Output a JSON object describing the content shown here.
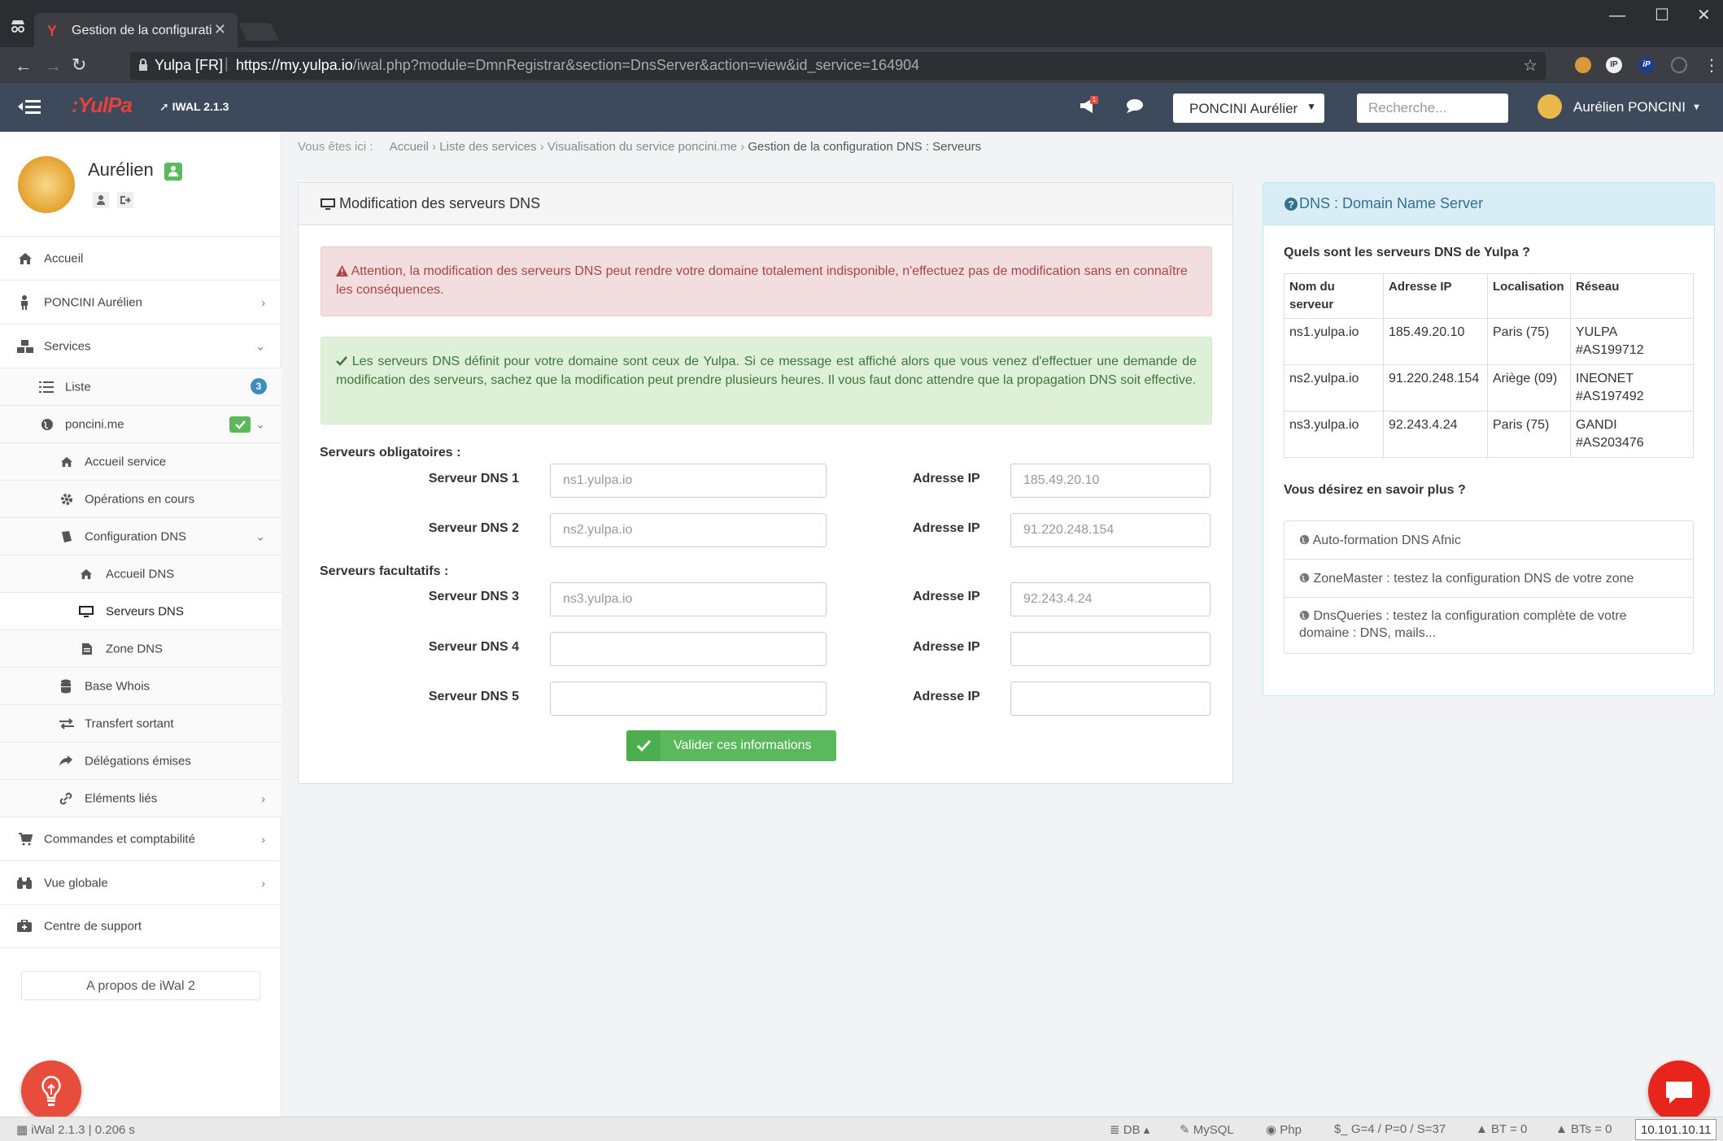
{
  "browser": {
    "tab_title": "Gestion de la configuratic",
    "site_name": "Yulpa [FR]",
    "url_host": "https://my.yulpa.io",
    "url_path": "/iwal.php?module=DmnRegistrar&section=DnsServer&action=view&id_service=164904"
  },
  "header": {
    "logo": ":YulPa",
    "version": "IWAL 2.1.3",
    "notif_count": "1",
    "user_select": "PONCINI Aurélier",
    "search_placeholder": "Recherche...",
    "user_name": "Aurélien PONCINI"
  },
  "sidebar": {
    "profile_name": "Aurélien",
    "items": [
      {
        "label": "Accueil"
      },
      {
        "label": "PONCINI Aurélien"
      },
      {
        "label": "Services"
      },
      {
        "label": "Liste",
        "badge": "3"
      },
      {
        "label": "poncini.me"
      },
      {
        "label": "Accueil service"
      },
      {
        "label": "Opérations en cours"
      },
      {
        "label": "Configuration DNS"
      },
      {
        "label": "Accueil DNS"
      },
      {
        "label": "Serveurs DNS"
      },
      {
        "label": "Zone DNS"
      },
      {
        "label": "Base Whois"
      },
      {
        "label": "Transfert sortant"
      },
      {
        "label": "Délégations émises"
      },
      {
        "label": "Eléments liés"
      },
      {
        "label": "Commandes et comptabilité"
      },
      {
        "label": "Vue globale"
      },
      {
        "label": "Centre de support"
      }
    ],
    "about": "A propos de iWal 2"
  },
  "breadcrumb": {
    "prefix": "Vous êtes ici :",
    "items": [
      "Accueil",
      "Liste des services",
      "Visualisation du service poncini.me"
    ],
    "current": "Gestion de la configuration DNS : Serveurs"
  },
  "main": {
    "title": "Modification des serveurs DNS",
    "alert_danger": "Attention, la modification des serveurs DNS peut rendre votre domaine totalement indisponible, n'effectuez pas de modification sans en connaître les conséquences.",
    "alert_success": "Les serveurs DNS définit pour votre domaine sont ceux de Yulpa. Si ce message est affiché alors que vous venez d'effectuer une demande de modification des serveurs, sachez que la modification peut prendre plusieurs heures. Il vous faut donc attendre que la propagation DNS soit effective.",
    "section_required": "Serveurs obligatoires :",
    "section_optional": "Serveurs facultatifs :",
    "ip_label": "Adresse IP",
    "rows": [
      {
        "label": "Serveur DNS 1",
        "dns_placeholder": "ns1.yulpa.io",
        "ip_placeholder": "185.49.20.10"
      },
      {
        "label": "Serveur DNS 2",
        "dns_placeholder": "ns2.yulpa.io",
        "ip_placeholder": "91.220.248.154"
      },
      {
        "label": "Serveur DNS 3",
        "dns_placeholder": "ns3.yulpa.io",
        "ip_placeholder": "92.243.4.24"
      },
      {
        "label": "Serveur DNS 4",
        "dns_placeholder": "",
        "ip_placeholder": ""
      },
      {
        "label": "Serveur DNS 5",
        "dns_placeholder": "",
        "ip_placeholder": ""
      }
    ],
    "submit": "Valider ces informations"
  },
  "info": {
    "title": "DNS : Domain Name Server",
    "question1": "Quels sont les serveurs DNS de Yulpa ?",
    "table_headers": [
      "Nom du serveur",
      "Adresse IP",
      "Localisation",
      "Réseau"
    ],
    "table_rows": [
      [
        "ns1.yulpa.io",
        "185.49.20.10",
        "Paris (75)",
        "YULPA #AS199712"
      ],
      [
        "ns2.yulpa.io",
        "91.220.248.154",
        "Ariège (09)",
        "INEONET #AS197492"
      ],
      [
        "ns3.yulpa.io",
        "92.243.4.24",
        "Paris (75)",
        "GANDI #AS203476"
      ]
    ],
    "question2": "Vous désirez en savoir plus ?",
    "links": [
      "Auto-formation DNS Afnic",
      "ZoneMaster : testez la configuration DNS de votre zone",
      "DnsQueries : testez la configuration complète de votre domaine : DNS, mails..."
    ]
  },
  "status": {
    "app": "iWal 2.1.3 | 0.206 s",
    "db": "DB",
    "mysql": "MySQL",
    "php": "Php",
    "counts": "$_ G=4 / P=0 / S=37",
    "bt": "BT = 0",
    "bts": "BTs = 0",
    "ip": "10.101.10.11"
  },
  "colors": {
    "header_bg": "#3d4a5c",
    "success": "#5cb85c",
    "danger_bg": "#f2dede",
    "info_bg": "#d9edf7",
    "fab": "#e8251c"
  }
}
